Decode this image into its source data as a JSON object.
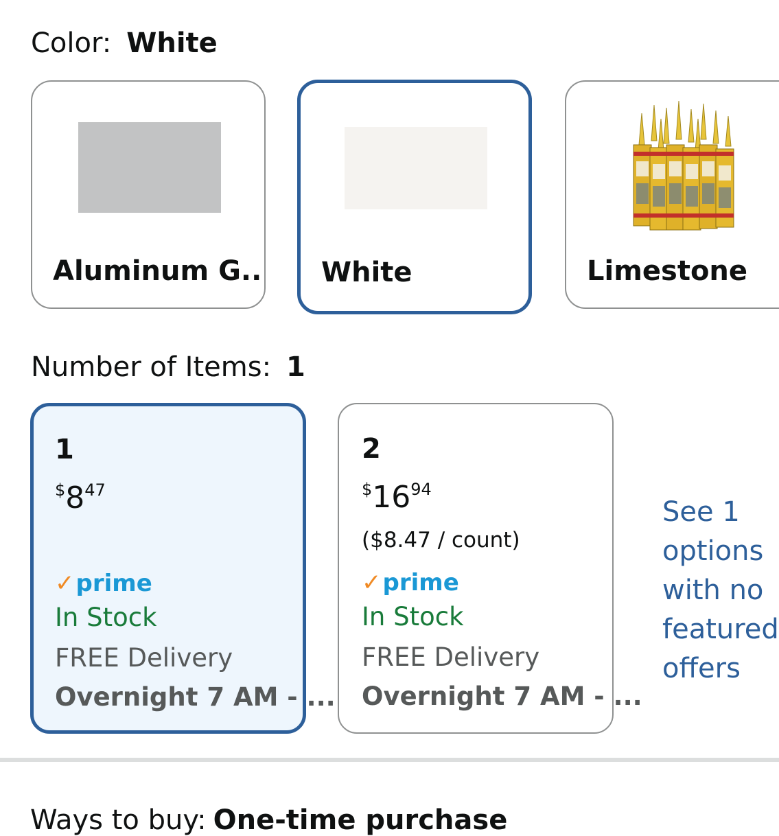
{
  "color": {
    "label": "Color:",
    "selected": "White",
    "options": [
      {
        "name": "Aluminum G...",
        "chip": "#c2c3c4"
      },
      {
        "name": "White",
        "chip": "#f5f3f0"
      },
      {
        "name": "Limestone",
        "image": "sealant-tubes-icon"
      }
    ]
  },
  "items": {
    "label": "Number of Items:",
    "selected": "1",
    "options": [
      {
        "count": "1",
        "price_symbol": "$",
        "price_whole": "8",
        "price_fraction": "47",
        "unit_price": "",
        "prime": "prime",
        "stock": "In Stock",
        "delivery": "FREE Delivery",
        "eta": "Overnight 7 AM - ..."
      },
      {
        "count": "2",
        "price_symbol": "$",
        "price_whole": "16",
        "price_fraction": "94",
        "unit_price": "($8.47 / count)",
        "prime": "prime",
        "stock": "In Stock",
        "delivery": "FREE Delivery",
        "eta": "Overnight 7 AM - ..."
      }
    ],
    "see_more": "See 1 options\nwith no\nfeatured\noffers"
  },
  "ways_to_buy": {
    "label": "Ways to buy:",
    "value": "One-time purchase"
  },
  "colors": {
    "selected_border": "#2d5f9a",
    "prime_blue": "#1a98d5",
    "prime_check": "#f08a24",
    "in_stock": "#197b3a",
    "link": "#2d5f9a"
  }
}
